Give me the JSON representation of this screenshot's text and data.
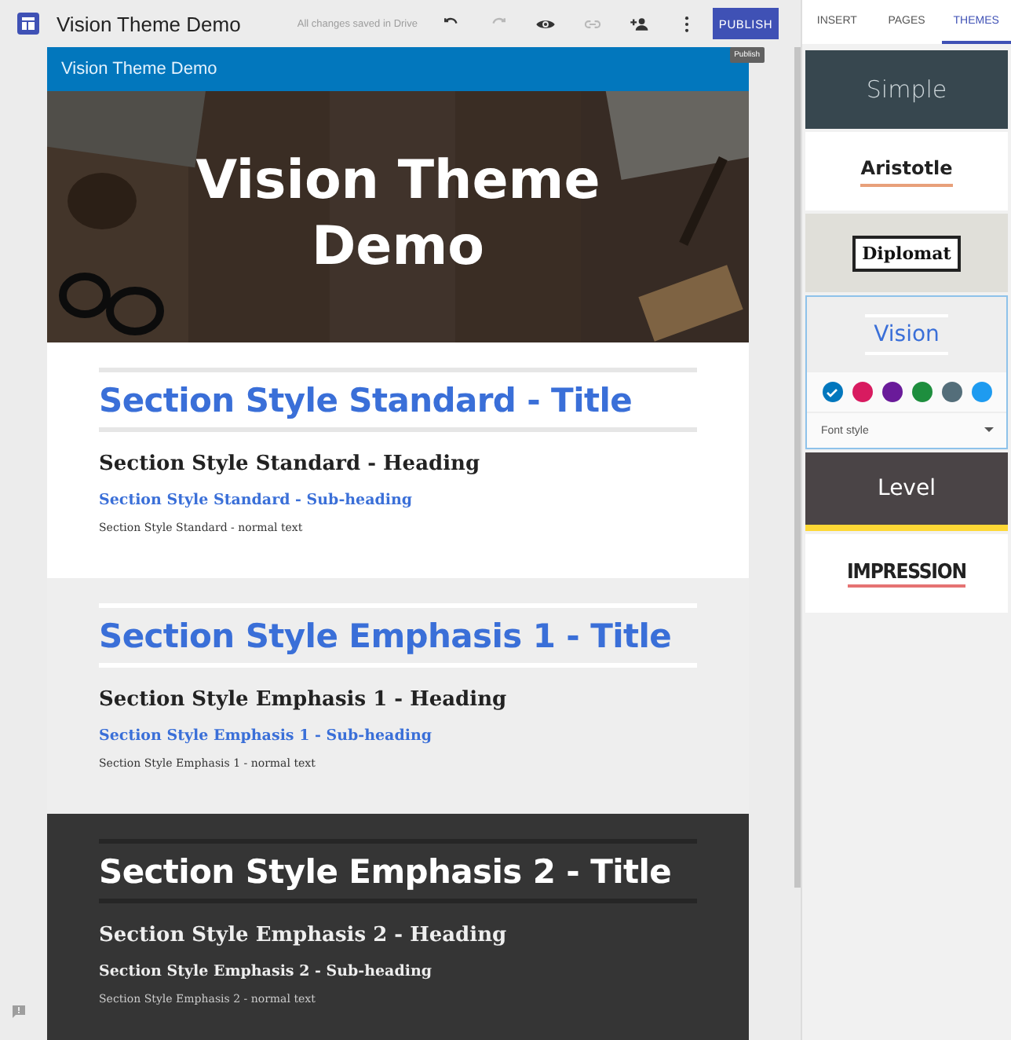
{
  "app": {
    "title": "Vision Theme Demo",
    "save_status": "All changes saved in Drive",
    "toolbar": [
      {
        "kind": "undo",
        "disabled": false
      },
      {
        "kind": "redo",
        "disabled": true
      },
      {
        "kind": "preview",
        "disabled": false
      },
      {
        "kind": "link",
        "disabled": true
      },
      {
        "kind": "share",
        "disabled": false
      },
      {
        "kind": "more",
        "disabled": false
      }
    ],
    "publish_button": "PUBLISH",
    "tooltip": "Publish"
  },
  "site": {
    "header_title": "Vision Theme Demo",
    "hero_title": "Vision Theme Demo",
    "sections": [
      {
        "kind": "standard",
        "title": "Section Style Standard - Title",
        "heading": "Section Style Standard - Heading",
        "subheading": "Section Style Standard - Sub-heading",
        "text": "Section Style Standard - normal text"
      },
      {
        "kind": "emphasis1",
        "title": "Section Style Emphasis 1 - Title",
        "heading": "Section Style Emphasis 1 - Heading",
        "subheading": "Section Style Emphasis 1 - Sub-heading",
        "text": "Section Style Emphasis 1 - normal text"
      },
      {
        "kind": "emphasis2",
        "title": "Section Style Emphasis 2 - Title",
        "heading": "Section Style Emphasis 2 - Heading",
        "subheading": "Section Style Emphasis 2 - Sub-heading",
        "text": "Section Style Emphasis 2 - normal text"
      }
    ]
  },
  "panel": {
    "tabs": [
      {
        "label": "INSERT",
        "selected": false
      },
      {
        "label": "PAGES",
        "selected": false
      },
      {
        "label": "THEMES",
        "selected": true
      }
    ],
    "themes": [
      {
        "kind": "simple",
        "name": "Simple",
        "selected": false
      },
      {
        "kind": "aristotle",
        "name": "Aristotle",
        "selected": false
      },
      {
        "kind": "diplomat",
        "name": "Diplomat",
        "selected": false
      },
      {
        "kind": "vision",
        "name": "Vision",
        "selected": true,
        "colors": [
          {
            "color": "#0277bd",
            "selected": true
          },
          {
            "color": "#d81b60",
            "selected": false
          },
          {
            "color": "#6a1b9a",
            "selected": false
          },
          {
            "color": "#1e8e3e",
            "selected": false
          },
          {
            "color": "#546e7a",
            "selected": false
          },
          {
            "color": "#1e9bf0",
            "selected": false
          }
        ],
        "font_style": "Font style"
      },
      {
        "kind": "level",
        "name": "Level",
        "selected": false
      },
      {
        "kind": "impression",
        "name": "IMPRESSION",
        "selected": false
      }
    ]
  }
}
